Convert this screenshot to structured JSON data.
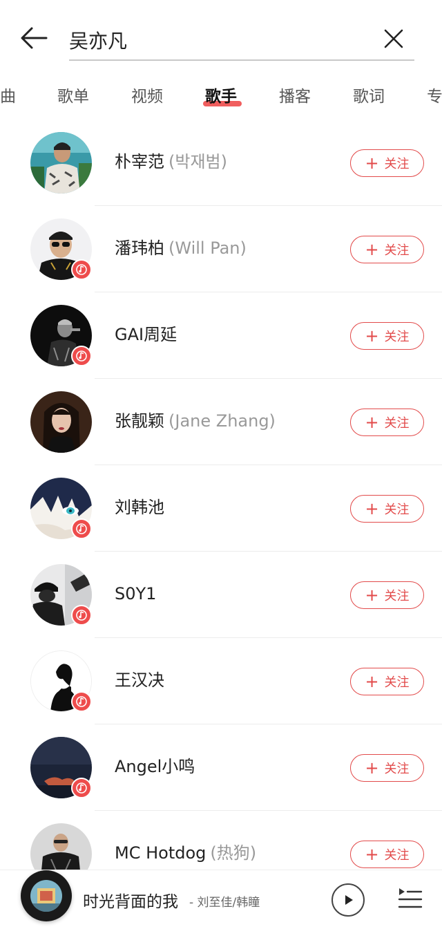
{
  "search": {
    "value": "吴亦凡"
  },
  "tabs": [
    {
      "label": "曲"
    },
    {
      "label": "歌单"
    },
    {
      "label": "视频"
    },
    {
      "label": "歌手",
      "active": true
    },
    {
      "label": "播客"
    },
    {
      "label": "歌词"
    },
    {
      "label": "专"
    }
  ],
  "artists": [
    {
      "name": "朴宰范",
      "alias": "(박재범)",
      "has_music_badge": false,
      "follow_label": "关注",
      "follow_icon": "plus-icon"
    },
    {
      "name": "潘玮柏",
      "alias": "(Will Pan)",
      "has_music_badge": true,
      "follow_label": "关注",
      "follow_icon": "plus-icon"
    },
    {
      "name": "GAI周延",
      "alias": "",
      "has_music_badge": true,
      "follow_label": "关注",
      "follow_icon": "plus-icon"
    },
    {
      "name": "张靓颖",
      "alias": "(Jane Zhang)",
      "has_music_badge": false,
      "follow_label": "关注",
      "follow_icon": "plus-icon"
    },
    {
      "name": "刘韩池",
      "alias": "",
      "has_music_badge": true,
      "follow_label": "关注",
      "follow_icon": "plus-icon"
    },
    {
      "name": "S0Y1",
      "alias": "",
      "has_music_badge": true,
      "follow_label": "关注",
      "follow_icon": "plus-icon"
    },
    {
      "name": "王汉决",
      "alias": "",
      "has_music_badge": true,
      "follow_label": "关注",
      "follow_icon": "plus-icon"
    },
    {
      "name": "Angel小鸣",
      "alias": "",
      "has_music_badge": true,
      "follow_label": "关注",
      "follow_icon": "plus-icon"
    },
    {
      "name": "MC Hotdog",
      "alias": "(热狗)",
      "has_music_badge": false,
      "follow_label": "关注",
      "follow_icon": "plus-icon"
    }
  ],
  "player": {
    "song_title": "时光背面的我",
    "song_artist": "- 刘至佳/韩瞳"
  },
  "colors": {
    "accent": "#e24a4a",
    "text": "#222222",
    "muted": "#999999"
  }
}
